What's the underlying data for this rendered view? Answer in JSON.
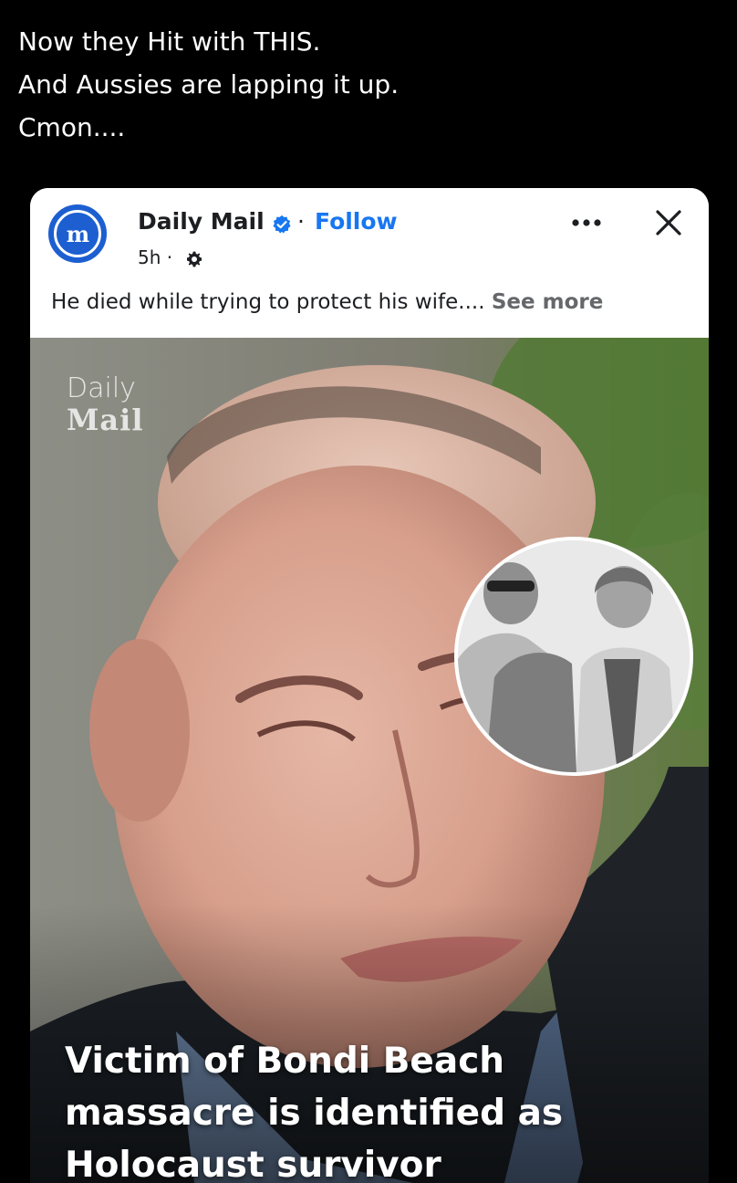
{
  "tweet": {
    "lines": [
      "Now they Hit with THIS.",
      "And Aussies are lapping it up.",
      "Cmon...."
    ]
  },
  "post": {
    "page_name": "Daily Mail",
    "separator": "·",
    "follow_label": "Follow",
    "time": "5h ·",
    "avatar_letter": "m",
    "caption": "He died while trying to protect his wife....",
    "see_more_label": "See more",
    "icons": {
      "verified": "verified-badge-icon",
      "audience": "gear-icon",
      "more": "more-horizontal-icon",
      "close": "close-icon"
    },
    "colors": {
      "link_blue": "#1877f2",
      "brand_blue": "#1d5fd1",
      "text": "#1c1e21",
      "muted": "#65676b"
    }
  },
  "image": {
    "watermark_line1": "Daily",
    "watermark_line2": "Mail",
    "headline_lines": [
      "Victim of Bondi Beach",
      "massacre is identified as",
      "Holocaust survivor"
    ]
  }
}
